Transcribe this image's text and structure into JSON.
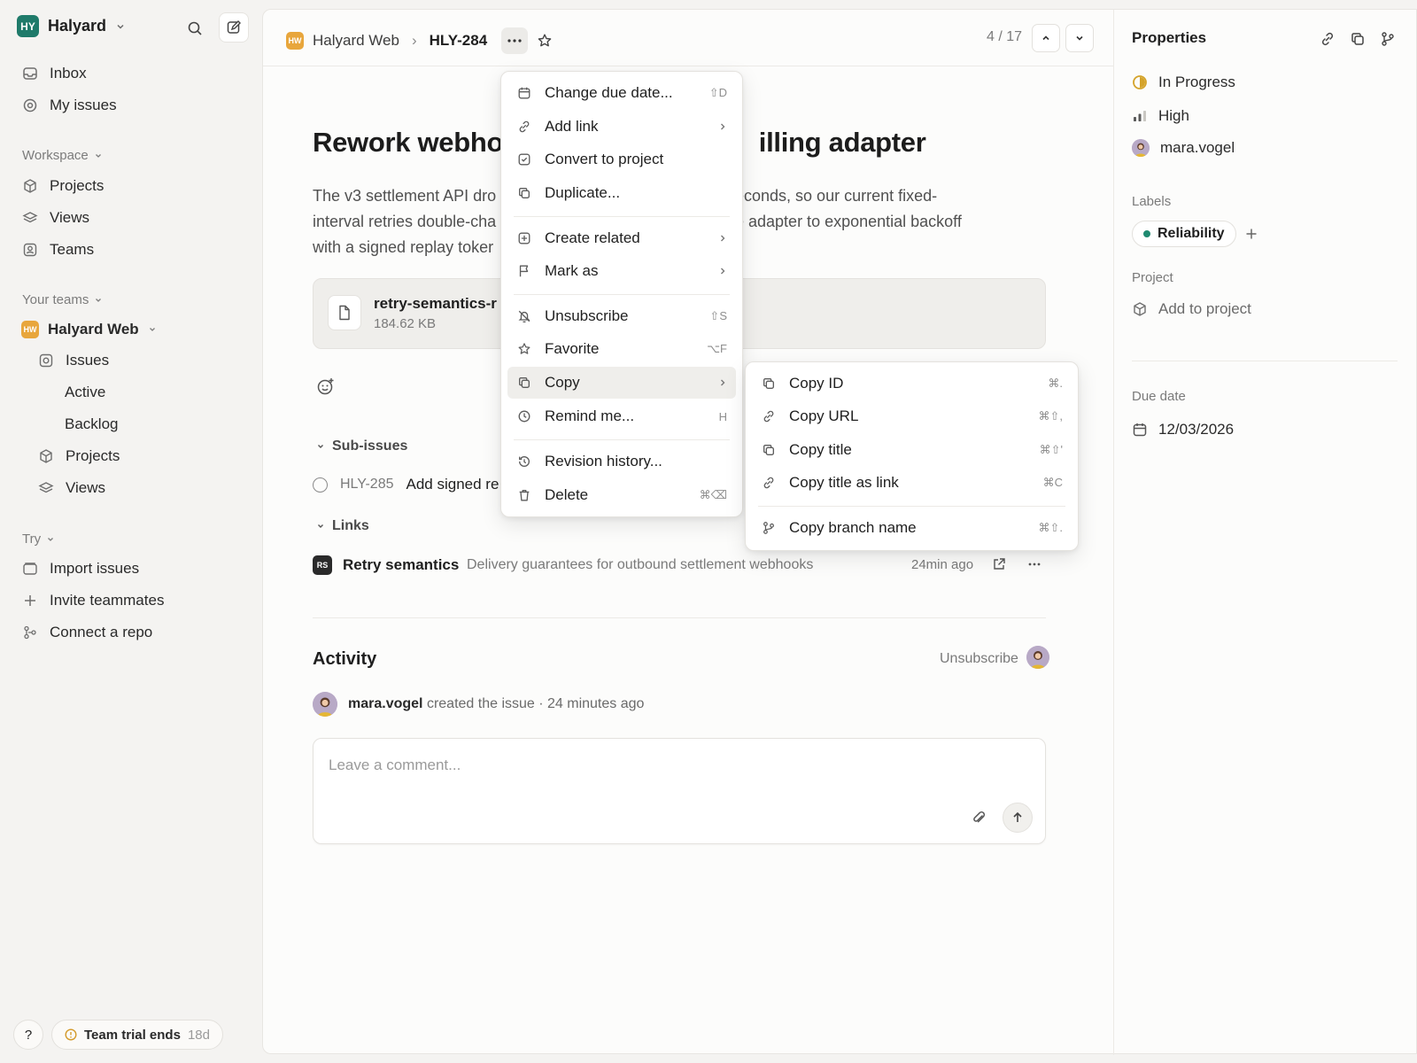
{
  "sidebar": {
    "workspace": {
      "initials": "HY",
      "name": "Halyard"
    },
    "nav": [
      {
        "label": "Inbox",
        "icon": "inbox-icon"
      },
      {
        "label": "My issues",
        "icon": "target-icon"
      }
    ],
    "workspace_section": "Workspace",
    "workspace_items": [
      {
        "label": "Projects",
        "icon": "cube-icon"
      },
      {
        "label": "Views",
        "icon": "layers-icon"
      },
      {
        "label": "Teams",
        "icon": "teams-icon"
      }
    ],
    "teams_section": "Your teams",
    "team": {
      "initials": "HW",
      "name": "Halyard Web"
    },
    "team_items": {
      "issues": "Issues",
      "active": "Active",
      "backlog": "Backlog",
      "projects": "Projects",
      "views": "Views"
    },
    "try_section": "Try",
    "try_items": [
      {
        "label": "Import issues",
        "icon": "import-icon"
      },
      {
        "label": "Invite teammates",
        "icon": "plus-icon"
      },
      {
        "label": "Connect a repo",
        "icon": "repo-icon"
      }
    ],
    "help": "?",
    "trial": {
      "label": "Team trial ends",
      "days": "18d"
    }
  },
  "header": {
    "team_initials": "HW",
    "team": "Halyard Web",
    "separator": "›",
    "issue_id": "HLY-284",
    "pager": "4 / 17"
  },
  "issue": {
    "title_left": "Rework webhoo",
    "title_right": "illing adapter",
    "desc_lines": [
      {
        "left": "The v3 settlement API dro",
        "right": "econds, so our current fixed-"
      },
      {
        "left": "interval retries double-cha",
        "right": "e adapter to exponential backoff"
      },
      {
        "left": "with a signed replay toker",
        "right": ""
      }
    ],
    "attachment": {
      "name": "retry-semantics-r",
      "size": "184.62 KB"
    },
    "subissues_label": "Sub-issues",
    "subissue": {
      "id": "HLY-285",
      "title": "Add signed re"
    },
    "links_label": "Links",
    "link": {
      "badge": "RS",
      "title": "Retry semantics",
      "desc": "Delivery guarantees for outbound settlement webhooks",
      "time": "24min ago"
    }
  },
  "activity": {
    "title": "Activity",
    "unsubscribe": "Unsubscribe",
    "entry_user": "mara.vogel",
    "entry_text": "created the issue · 24 minutes ago",
    "comment_placeholder": "Leave a comment..."
  },
  "properties": {
    "title": "Properties",
    "status": "In Progress",
    "priority": "High",
    "assignee": "mara.vogel",
    "labels_label": "Labels",
    "label_chip": "Reliability",
    "project_label": "Project",
    "project_value": "Add to project",
    "due_label": "Due date",
    "due_value": "12/03/2026"
  },
  "menu": {
    "items": [
      {
        "label": "Change due date...",
        "icon": "calendar-icon",
        "shortcut": "⇧D"
      },
      {
        "label": "Add link",
        "icon": "link-icon",
        "submenu": true
      },
      {
        "label": "Convert to project",
        "icon": "check-square-icon"
      },
      {
        "label": "Duplicate...",
        "icon": "duplicate-icon"
      },
      {
        "label": "Create related",
        "icon": "plus-square-icon",
        "submenu": true
      },
      {
        "label": "Mark as",
        "icon": "flag-icon",
        "submenu": true
      },
      {
        "label": "Unsubscribe",
        "icon": "bell-off-icon",
        "shortcut": "⇧S"
      },
      {
        "label": "Favorite",
        "icon": "star-icon",
        "shortcut": "⌥F"
      },
      {
        "label": "Copy",
        "icon": "copy-icon",
        "submenu": true
      },
      {
        "label": "Remind me...",
        "icon": "clock-icon",
        "shortcut": "H"
      },
      {
        "label": "Revision history...",
        "icon": "history-icon"
      },
      {
        "label": "Delete",
        "icon": "trash-icon",
        "shortcut": "⌘⌫"
      }
    ]
  },
  "submenu": {
    "items": [
      {
        "label": "Copy ID",
        "icon": "copy-icon",
        "shortcut": "⌘."
      },
      {
        "label": "Copy URL",
        "icon": "link-icon",
        "shortcut": "⌘⇧,"
      },
      {
        "label": "Copy title",
        "icon": "copy-icon",
        "shortcut": "⌘⇧'"
      },
      {
        "label": "Copy title as link",
        "icon": "link-icon",
        "shortcut": "⌘C"
      },
      {
        "label": "Copy branch name",
        "icon": "branch-icon",
        "shortcut": "⌘⇧."
      }
    ]
  },
  "colors": {
    "accent_team": "#e8a63c",
    "workspace": "#1f7a6a",
    "label_dot": "#1f8a70",
    "status": "#d4a32a"
  }
}
